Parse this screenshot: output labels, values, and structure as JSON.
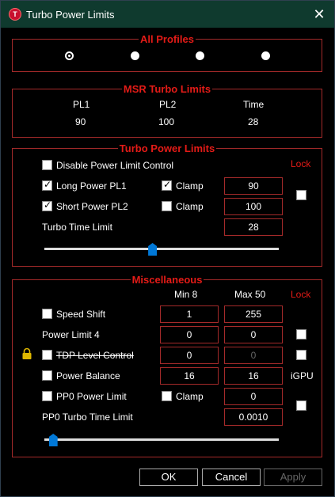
{
  "window": {
    "title": "Turbo Power Limits",
    "app_icon": "T"
  },
  "colors": {
    "accent_red": "#e41b17",
    "border_red": "#a52a2a",
    "titlebar": "#0f3a2e",
    "slider_thumb": "#0078d7"
  },
  "all_profiles": {
    "title": "All Profiles"
  },
  "msr": {
    "title": "MSR Turbo Limits",
    "headers": [
      "PL1",
      "PL2",
      "Time"
    ],
    "values": [
      "90",
      "100",
      "28"
    ]
  },
  "tpl": {
    "title": "Turbo Power Limits",
    "disable_label": "Disable Power Limit Control",
    "lock_label": "Lock",
    "long_label": "Long Power PL1",
    "long_clamp": "Clamp",
    "long_value": "90",
    "short_label": "Short Power PL2",
    "short_clamp": "Clamp",
    "short_value": "100",
    "time_label": "Turbo Time Limit",
    "time_value": "28",
    "slider_fraction": 0.46
  },
  "misc": {
    "title": "Miscellaneous",
    "min_label": "Min  8",
    "max_label": "Max  50",
    "lock_label": "Lock",
    "speed_shift_label": "Speed Shift",
    "speed_shift_min": "1",
    "speed_shift_max": "255",
    "pl4_label": "Power Limit 4",
    "pl4_min": "0",
    "pl4_max": "0",
    "tdp_label": "TDP Level Control",
    "tdp_min": "0",
    "tdp_max": "0",
    "pb_label": "Power Balance",
    "pb_min": "16",
    "pb_max": "16",
    "igpu_label": "iGPU",
    "pp0_label": "PP0 Power Limit",
    "pp0_clamp": "Clamp",
    "pp0_value": "0",
    "pp0_time_label": "PP0 Turbo Time Limit",
    "pp0_time_value": "0.0010",
    "slider_fraction": 0.02
  },
  "buttons": {
    "ok": "OK",
    "cancel": "Cancel",
    "apply": "Apply"
  }
}
